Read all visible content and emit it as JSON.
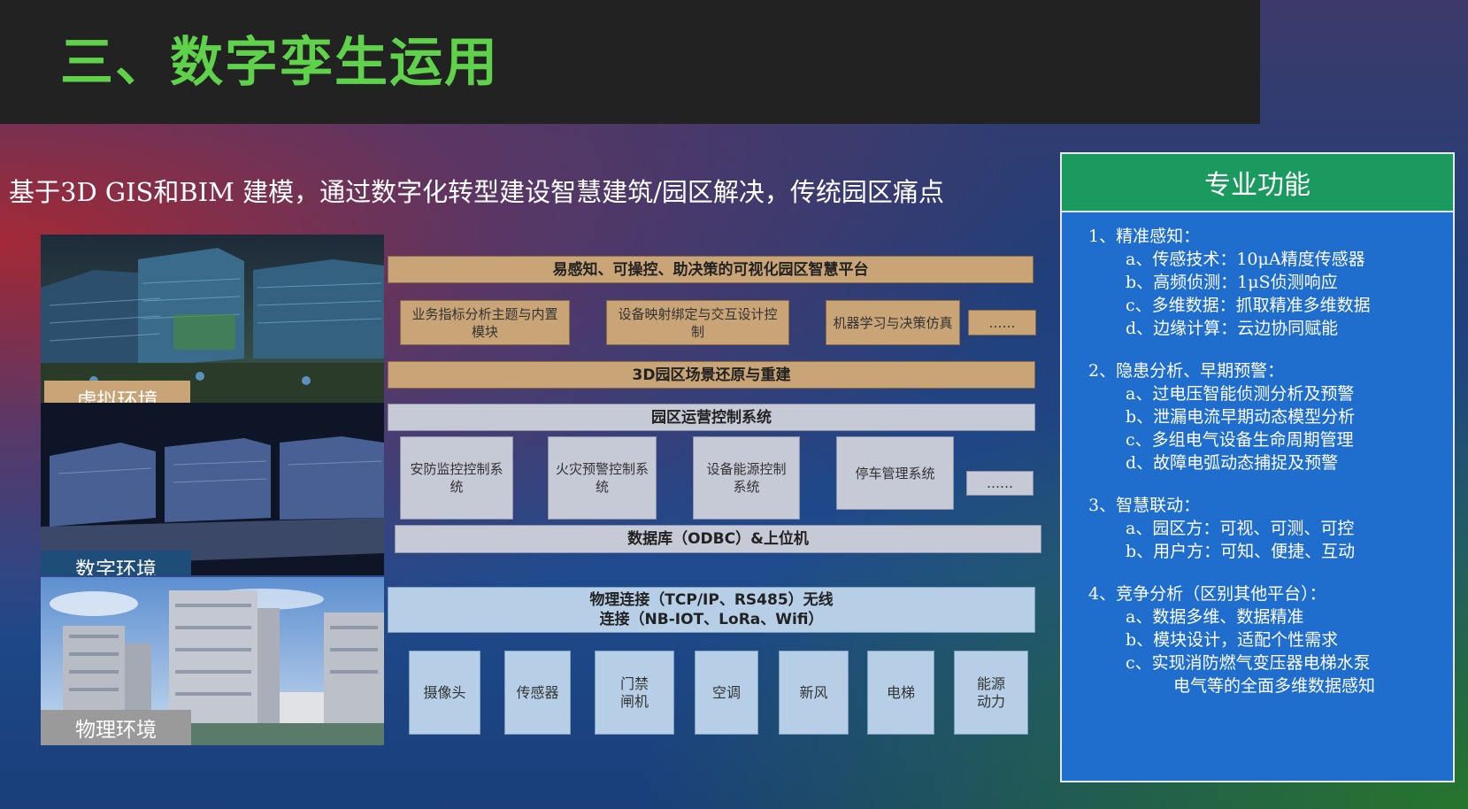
{
  "title": "三、数字孪生运用",
  "subtitle": "基于3D GIS和BIM 建模，通过数字化转型建设智慧建筑/园区解决，传统园区痛点",
  "photos": {
    "virtual": "虚拟环境",
    "digital": "数字环境",
    "physical": "物理环境"
  },
  "diagram": {
    "platform": "易感知、可操控、助决策的可视化园区智慧平台",
    "modules": [
      "业务指标分析主题与内置模块",
      "设备映射绑定与交互设计控制",
      "机器学习与决策仿真",
      "……"
    ],
    "scene": "3D园区场景还原与重建",
    "ops_system": "园区运营控制系统",
    "subsystems": [
      "安防监控控制系统",
      "火灾预警控制系统",
      "设备能源控制系统",
      "停车管理系统",
      "……"
    ],
    "database": "数据库（ODBC）&上位机",
    "connection_line1": "物理连接（TCP/IP、RS485）无线",
    "connection_line2": "连接（NB-IOT、LoRa、Wifi）",
    "devices": [
      "摄像头",
      "传感器",
      "门禁闸机",
      "空调",
      "新风",
      "电梯",
      "能源动力"
    ]
  },
  "panel": {
    "heading": "专业功能",
    "sections": [
      {
        "title": "1、精准感知：",
        "items": [
          "a、传感技术：10μA精度传感器",
          "b、高频侦测：1μS侦测响应",
          "c、多维数据：抓取精准多维数据",
          "d、边缘计算：云边协同赋能"
        ]
      },
      {
        "title": "2、隐患分析、早期预警：",
        "items": [
          "a、过电压智能侦测分析及预警",
          "b、泄漏电流早期动态模型分析",
          "c、多组电气设备生命周期管理",
          "d、故障电弧动态捕捉及预警"
        ]
      },
      {
        "title": "3、智慧联动：",
        "items": [
          "a、园区方：可视、可测、可控",
          "b、用户方：可知、便捷、互动"
        ]
      },
      {
        "title": "4、竞争分析（区别其他平台）：",
        "items": [
          "a、数据多维、数据精准",
          "b、模块设计，适配个性需求",
          "c、实现消防燃气变压器电梯水泵"
        ],
        "continuation": "电气等的全面多维数据感知"
      }
    ]
  },
  "colors": {
    "title_green": "#5fd14a",
    "tan_box": "#c9a477",
    "grey_box": "#c6c9d6",
    "light_blue_box": "#b6cfe6",
    "panel_blue": "#1f6dcc",
    "panel_head_green": "#1a9a5e"
  }
}
